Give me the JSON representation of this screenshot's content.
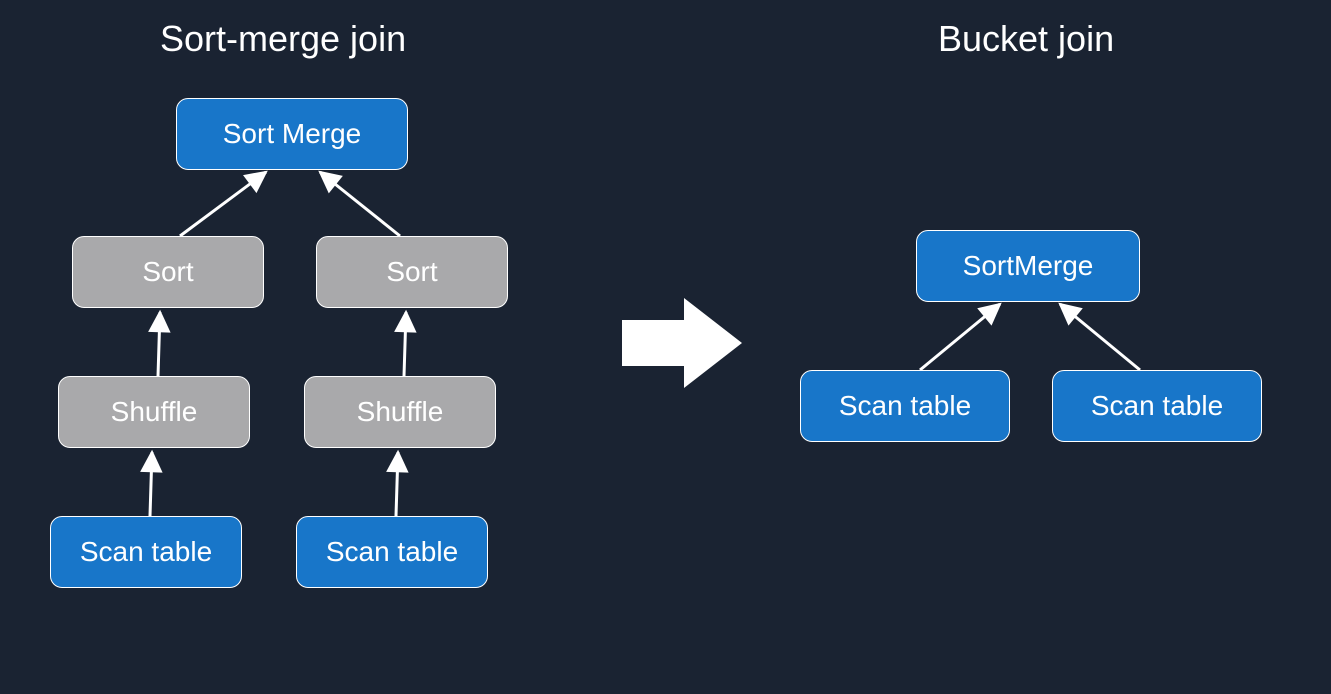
{
  "left": {
    "title": "Sort-merge join",
    "root": "Sort Merge",
    "sort_left": "Sort",
    "sort_right": "Sort",
    "shuffle_left": "Shuffle",
    "shuffle_right": "Shuffle",
    "scan_left": "Scan table",
    "scan_right": "Scan table"
  },
  "right": {
    "title": "Bucket join",
    "root": "SortMerge",
    "scan_left": "Scan table",
    "scan_right": "Scan table"
  },
  "colors": {
    "background": "#1a2332",
    "blue": "#1876c9",
    "gray": "#a9a9ab",
    "stroke": "#ffffff"
  }
}
